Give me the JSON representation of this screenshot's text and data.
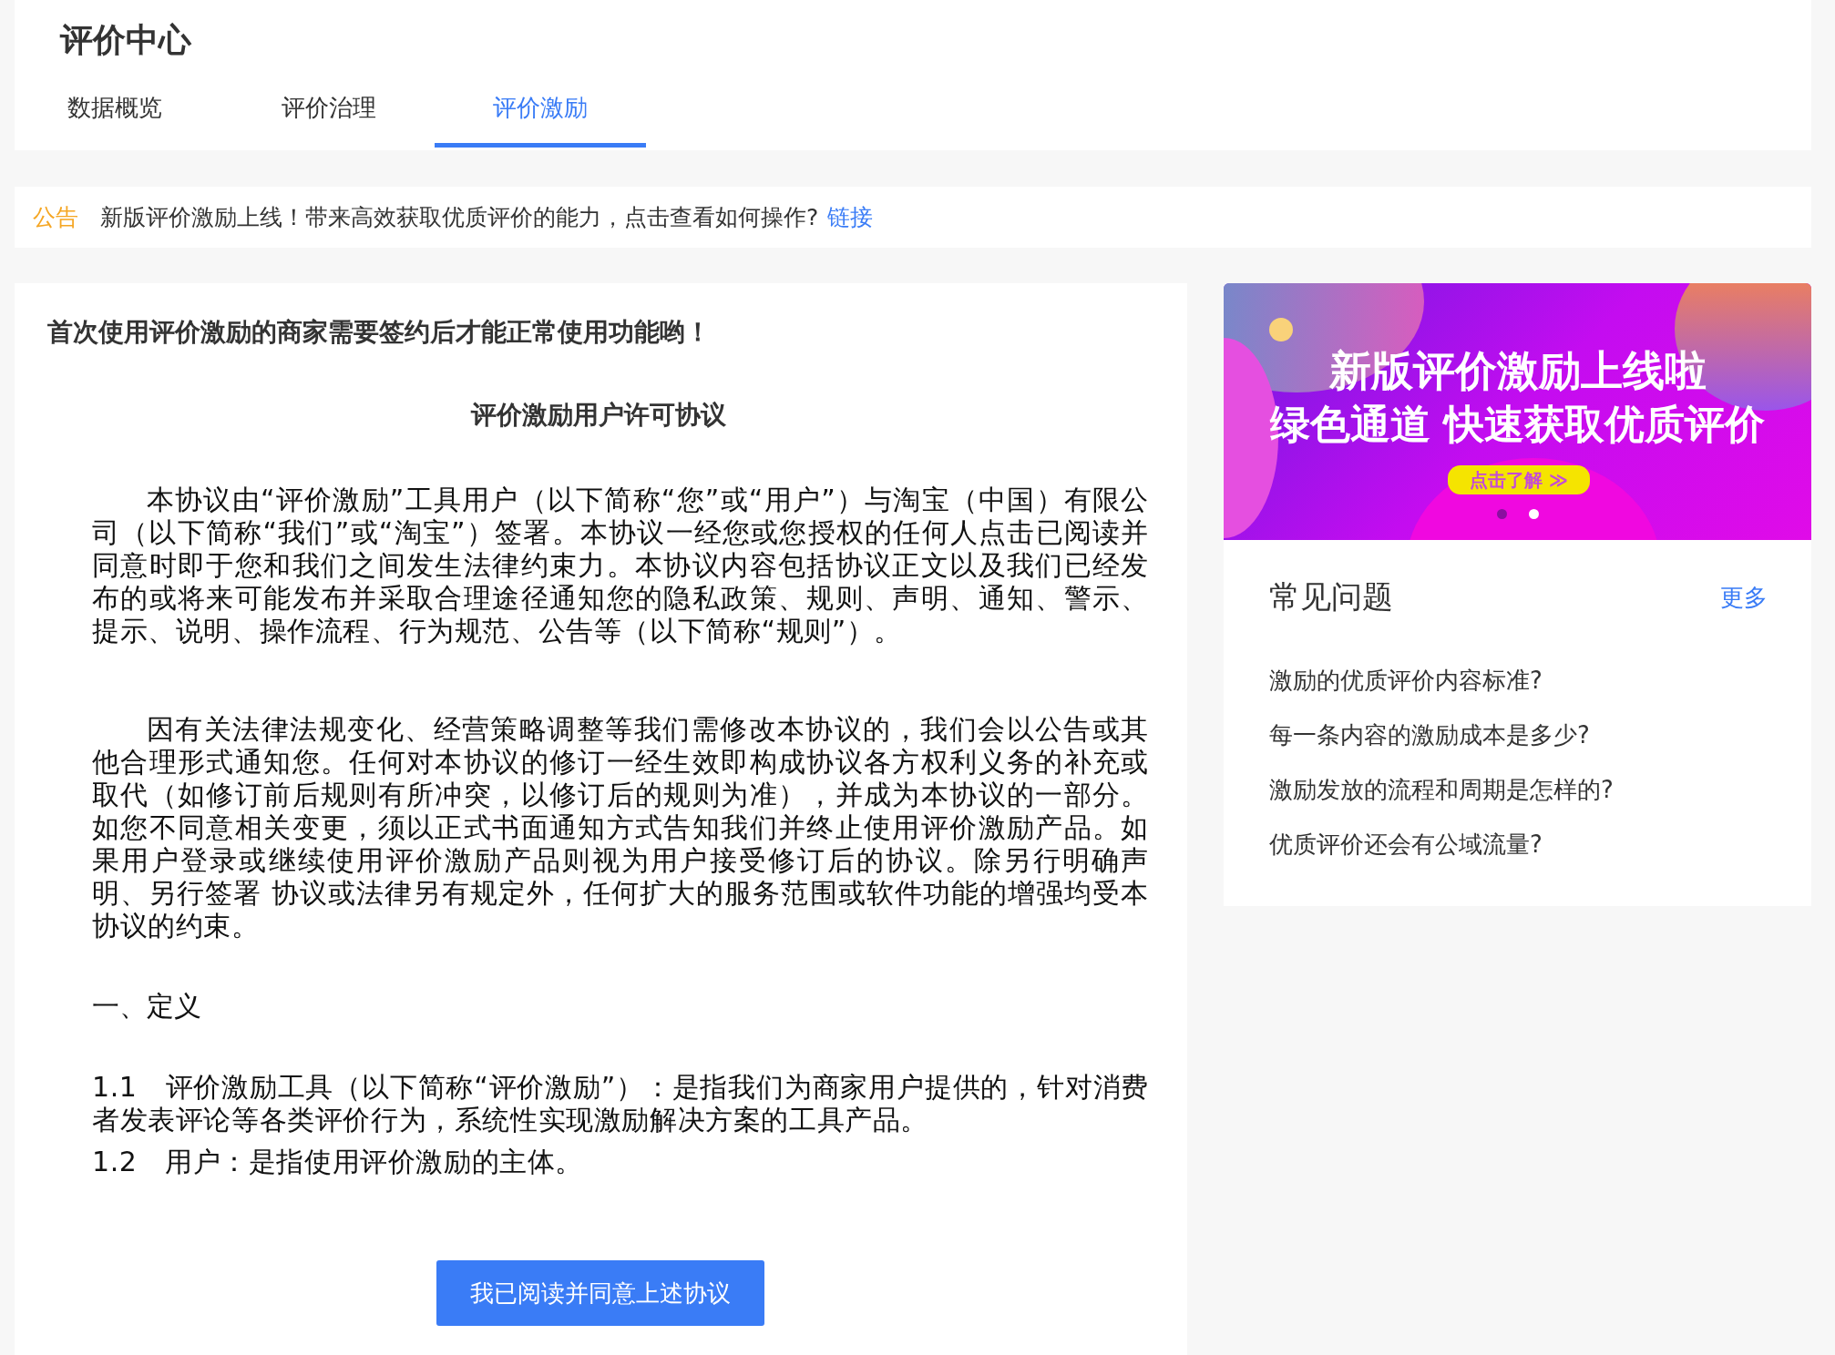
{
  "page": {
    "title": "评价中心"
  },
  "tabs": [
    {
      "label": "数据概览",
      "selected": false
    },
    {
      "label": "评价治理",
      "selected": false
    },
    {
      "label": "评价激励",
      "selected": true
    }
  ],
  "notice": {
    "tag": "公告",
    "text": "新版评价激励上线！带来高效获取优质评价的能力，点击查看如何操作?",
    "link": "链接"
  },
  "agreement": {
    "intro": "首次使用评价激励的商家需要签约后才能正常使用功能哟！",
    "title": "评价激励用户许可协议",
    "blocks": [
      {
        "kind": "paragraph",
        "text": "本协议由“评价激励”工具用户（以下简称“您”或“用户”）与淘宝（中国）有限公司（以下简称“我们”或“淘宝”）签署。本协议一经您或您授权的任何人点击已阅读并同意时即于您和我们之间发生法律约束力。本协议内容包括协议正文以及我们已经发布的或将来可能发布并采取合理途径通知您的隐私政策、规则、声明、通知、警示、提示、说明、操作流程、行为规范、公告等（以下简称“规则”）。"
      },
      {
        "kind": "paragraph",
        "text": "因有关法律法规变化、经营策略调整等我们需修改本协议的，我们会以公告或其他合理形式通知您。任何对本协议的修订一经生效即构成协议各方权利义务的补充或取代（如修订前后规则有所冲突，以修订后的规则为准），并成为本协议的一部分。如您不同意相关变更，须以正式书面通知方式告知我们并终止使用评价激励产品。如果用户登录或继续使用评价激励产品则视为用户接受修订后的协议。除另行明确声明、另行签署 协议或法律另有规定外，任何扩大的服务范围或软件功能的增强均受本协议的约束。"
      },
      {
        "kind": "heading",
        "text": "一、定义"
      },
      {
        "kind": "clause",
        "number": "1.1",
        "text": "评价激励工具（以下简称“评价激励”）：是指我们为商家用户提供的，针对消费者发表评论等各类评价行为，系统性实现激励解决方案的工具产品。"
      },
      {
        "kind": "clause",
        "number": "1.2",
        "text": "用户：是指使用评价激励的主体。"
      }
    ],
    "button": "我已阅读并同意上述协议"
  },
  "banner": {
    "line_1": "新版评价激励上线啦",
    "line_2": "绿色通道 快速获取优质评价",
    "button": "点击了解 ≫",
    "dots": [
      {
        "selected": false
      },
      {
        "selected": true
      }
    ]
  },
  "faq": {
    "title": "常见问题",
    "more": "更多",
    "items": [
      "激励的优质评价内容标准?",
      "每一条内容的激励成本是多少?",
      "激励发放的流程和周期是怎样的?",
      "优质评价还会有公域流量?"
    ]
  }
}
